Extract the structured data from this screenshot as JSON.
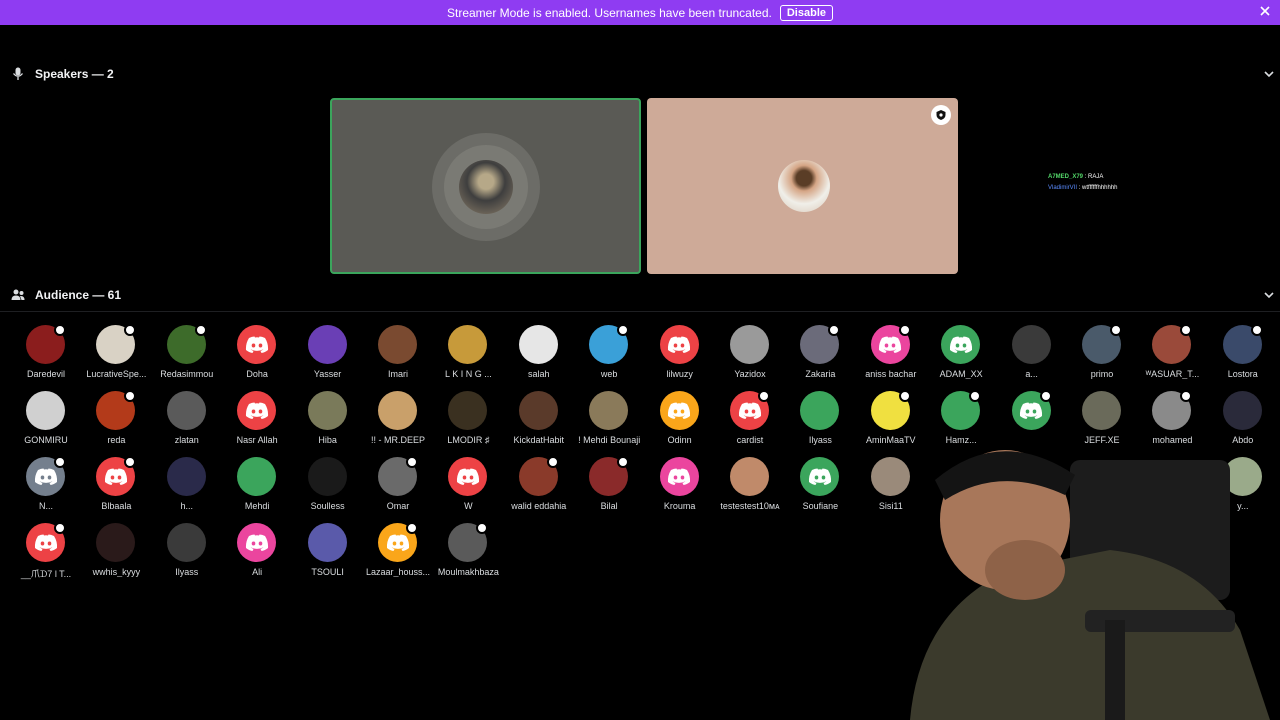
{
  "banner": {
    "message": "Streamer Mode is enabled. Usernames have been truncated.",
    "disable_label": "Disable"
  },
  "speakers": {
    "title": "Speakers — 2"
  },
  "audience": {
    "title": "Audience — 61"
  },
  "chat": [
    {
      "name": "A7MED_X79",
      "text": "RAJA"
    },
    {
      "name": "VladimirVII",
      "text": "wtffffffhhhhhh"
    }
  ],
  "colors": {
    "banner": "#8f3cf2",
    "speaking_border": "#3ba55c",
    "discord_red": "#ed4245",
    "discord_green": "#3ba55c",
    "discord_pink": "#eb459e",
    "discord_yellow": "#faa61a",
    "discord_gray": "#747f8d"
  },
  "members": [
    {
      "name": "Daredevil",
      "color": "#8b1d1d",
      "mod": true
    },
    {
      "name": "LucrativeSpe...",
      "color": "#d9d2c5",
      "mod": true
    },
    {
      "name": "Redasimmou",
      "color": "#3d6b2a",
      "mod": true
    },
    {
      "name": "Doha",
      "color": "#ed4245",
      "discord": true
    },
    {
      "name": "Yasser",
      "color": "#6a3fb5"
    },
    {
      "name": "Imari",
      "color": "#7a4a30"
    },
    {
      "name": "L K I N G ...",
      "color": "#c79a3a"
    },
    {
      "name": "salah",
      "color": "#e6e6e6"
    },
    {
      "name": "web",
      "color": "#3aa0d8",
      "mod": true
    },
    {
      "name": "lilwuzy",
      "color": "#ed4245",
      "discord": true
    },
    {
      "name": "Yazidox",
      "color": "#9a9a9a"
    },
    {
      "name": "Zakaria",
      "color": "#6b6b7a",
      "mod": true
    },
    {
      "name": "aniss bachar",
      "color": "#eb459e",
      "discord": true,
      "mod": true
    },
    {
      "name": "ADAM_XX",
      "color": "#3ba55c",
      "discord": true
    },
    {
      "name": "a...",
      "color": "#3a3a3a"
    },
    {
      "name": "primo",
      "color": "#4a5a6a",
      "mod": true
    },
    {
      "name": "ᵂASUAR_T...",
      "color": "#9a4a3a",
      "mod": true
    },
    {
      "name": "Lostora",
      "color": "#3a4a6a",
      "mod": true
    },
    {
      "name": "GONMIRU",
      "color": "#d0d0d0"
    },
    {
      "name": "reda",
      "color": "#b33a1a",
      "mod": true
    },
    {
      "name": "zlatan",
      "color": "#5a5a5a"
    },
    {
      "name": "Nasr Allah",
      "color": "#ed4245",
      "discord": true
    },
    {
      "name": "Hiba",
      "color": "#7a7a5a"
    },
    {
      "name": "!! - MR.DEEP",
      "color": "#c9a06a"
    },
    {
      "name": "LMODIR ♯",
      "color": "#3a3020"
    },
    {
      "name": "KickdatHabit",
      "color": "#5a3a2a"
    },
    {
      "name": "! Mehdi Bounaji",
      "color": "#8a7a5a"
    },
    {
      "name": "Odinn",
      "color": "#faa61a",
      "discord": true
    },
    {
      "name": "cardist",
      "color": "#ed4245",
      "discord": true,
      "mod": true
    },
    {
      "name": "Ilyass",
      "color": "#3ba55c"
    },
    {
      "name": "AminMaaTV",
      "color": "#f0e040",
      "mod": true
    },
    {
      "name": "Hamz...",
      "color": "#3ba55c",
      "mod": true
    },
    {
      "name": "",
      "color": "#3ba55c",
      "discord": true,
      "mod": true
    },
    {
      "name": "JEFF.XE",
      "color": "#6a6a5a"
    },
    {
      "name": "mohamed",
      "color": "#8a8a8a",
      "mod": true
    },
    {
      "name": "Abdo",
      "color": "#2a2a3a"
    },
    {
      "name": "N...",
      "color": "#747f8d",
      "discord": true,
      "mod": true
    },
    {
      "name": "Blbaala",
      "color": "#ed4245",
      "discord": true,
      "mod": true
    },
    {
      "name": "h...",
      "color": "#2a2a4a"
    },
    {
      "name": "Mehdi",
      "color": "#3ba55c"
    },
    {
      "name": "Soulless",
      "color": "#1a1a1a"
    },
    {
      "name": "Omar",
      "color": "#6a6a6a",
      "mod": true
    },
    {
      "name": "W",
      "color": "#ed4245",
      "discord": true
    },
    {
      "name": "walid eddahia",
      "color": "#8a3a2a",
      "mod": true
    },
    {
      "name": "Bilal",
      "color": "#8a2a2a",
      "mod": true
    },
    {
      "name": "Krouma",
      "color": "#eb459e",
      "discord": true
    },
    {
      "name": "testestest10ᴍᴀ",
      "color": "#c08a6a"
    },
    {
      "name": "Soufiane",
      "color": "#3ba55c",
      "discord": true
    },
    {
      "name": "Sisi11",
      "color": "#9a8a7a"
    },
    {
      "name": "y...",
      "color": "#9aaa8a"
    },
    {
      "name": "__爪ᗪ7 l T...",
      "color": "#ed4245",
      "discord": true,
      "mod": true
    },
    {
      "name": "wwhis_kyyy",
      "color": "#2a1a1a"
    },
    {
      "name": "Ilyass",
      "color": "#3a3a3a"
    },
    {
      "name": "Ali",
      "color": "#eb459e",
      "discord": true
    },
    {
      "name": "TSOULI",
      "color": "#5a5aaa"
    },
    {
      "name": "Lazaar_houss...",
      "color": "#faa61a",
      "discord": true,
      "mod": true
    },
    {
      "name": "Moulmakhbaza",
      "color": "#5a5a5a",
      "mod": true
    }
  ]
}
